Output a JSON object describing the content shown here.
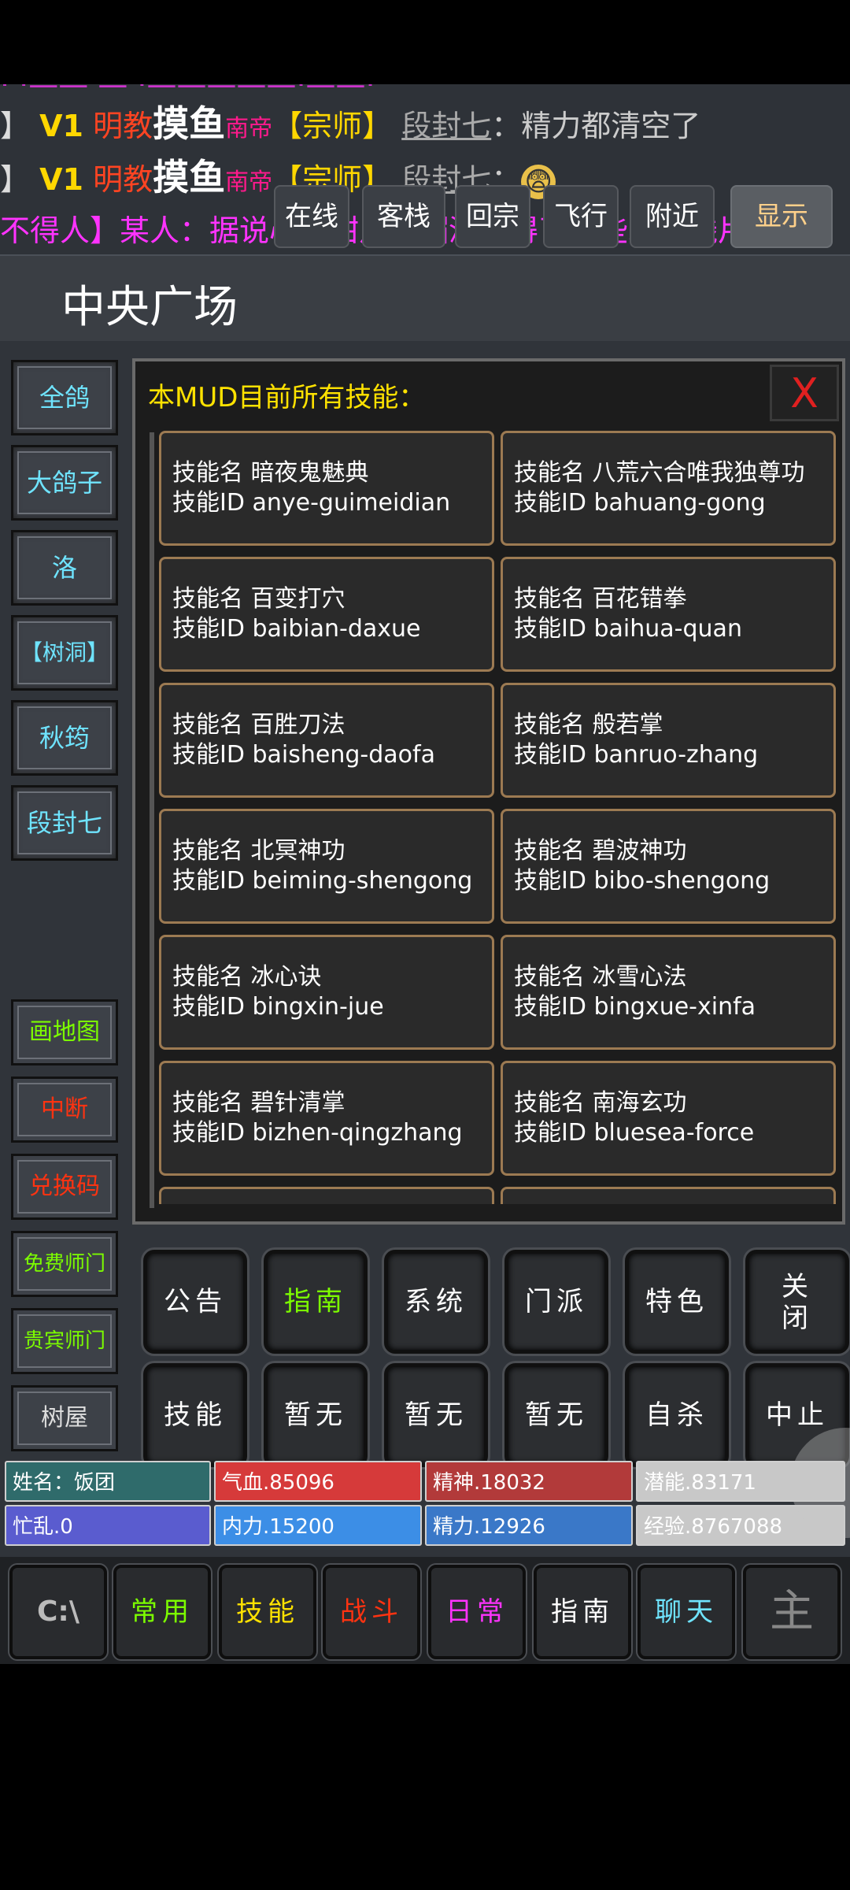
{
  "chat": {
    "cut_line": "· ·—— — ·—————·——·",
    "lines": [
      {
        "prefix": "】",
        "tag": "V1",
        "sect": "明教",
        "name": "摸鱼",
        "title": "南帝",
        "rank": "【宗师】",
        "speaker": "段封七",
        "colon": "：",
        "message": "精力都清空了"
      },
      {
        "prefix": "】",
        "tag": "V1",
        "sect": "明教",
        "name": "摸鱼",
        "title": "南帝",
        "rank": "【宗师】",
        "speaker": "段封七",
        "colon": "：",
        "message": "😨"
      }
    ],
    "system_line": "不得人】某人：据说心小甜从峨嵋派获得了一些水晶残片。"
  },
  "location": {
    "name": "中央广场",
    "buttons": [
      "在线",
      "客栈",
      "回宗",
      "飞行",
      "附近"
    ],
    "display": "显示"
  },
  "sidebar_players": [
    "全鸽",
    "大鸽子",
    "洛",
    "【树洞】",
    "秋筠",
    "段封七"
  ],
  "sidebar_tools": [
    {
      "label": "画地图",
      "color": "#7CFC00"
    },
    {
      "label": "中断",
      "color": "#ff3311"
    },
    {
      "label": "兑换码",
      "color": "#ff3311"
    },
    {
      "label": "免费师门",
      "color": "#7CFC00"
    },
    {
      "label": "贵宾师门",
      "color": "#7CFC00"
    },
    {
      "label": "树屋",
      "color": "#dddddd"
    }
  ],
  "panel": {
    "title": "本MUD目前所有技能：",
    "close": "X",
    "name_label": "技能名",
    "id_label": "技能ID",
    "skills": [
      {
        "name": "暗夜鬼魅典",
        "id": "anye-guimeidian"
      },
      {
        "name": "八荒六合唯我独尊功",
        "id": "bahuang-gong"
      },
      {
        "name": "百变打穴",
        "id": "baibian-daxue"
      },
      {
        "name": "百花错拳",
        "id": "baihua-quan"
      },
      {
        "name": "百胜刀法",
        "id": "baisheng-daofa"
      },
      {
        "name": "般若掌",
        "id": "banruo-zhang"
      },
      {
        "name": "北冥神功",
        "id": "beiming-shengong"
      },
      {
        "name": "碧波神功",
        "id": "bibo-shengong"
      },
      {
        "name": "冰心诀",
        "id": "bingxin-jue"
      },
      {
        "name": "冰雪心法",
        "id": "bingxue-xinfa"
      },
      {
        "name": "碧针清掌",
        "id": "bizhen-qingzhang"
      },
      {
        "name": "南海玄功",
        "id": "bluesea-force"
      }
    ]
  },
  "commands": [
    {
      "label": "公告",
      "color": "#ffffff"
    },
    {
      "label": "指南",
      "color": "#7CFC00"
    },
    {
      "label": "系统",
      "color": "#ffffff"
    },
    {
      "label": "门派",
      "color": "#ffffff"
    },
    {
      "label": "特色",
      "color": "#ffffff"
    },
    {
      "label": "关闭",
      "color": "#ffffff"
    },
    {
      "label": "技能",
      "color": "#ffffff"
    },
    {
      "label": "暂无",
      "color": "#ffffff"
    },
    {
      "label": "暂无",
      "color": "#ffffff"
    },
    {
      "label": "暂无",
      "color": "#ffffff"
    },
    {
      "label": "自杀",
      "color": "#ffffff"
    },
    {
      "label": "中止",
      "color": "#ffffff"
    }
  ],
  "stats": [
    {
      "label": "姓名：饭团",
      "color": "#2f6b6b",
      "fill": 1.0
    },
    {
      "label": "气血.85096",
      "color": "#d63a3a",
      "fill": 1.0
    },
    {
      "label": "精神.18032",
      "color": "#b23a3a",
      "fill": 1.0
    },
    {
      "label": "潜能.83171",
      "color": "#c8c8c8",
      "fill": 1.0
    },
    {
      "label": "忙乱.0",
      "color": "#5a5ccf",
      "fill": 1.0
    },
    {
      "label": "内力.15200",
      "color": "#3c8ee6",
      "fill": 1.0
    },
    {
      "label": "精力.12926",
      "color": "#3a78c8",
      "fill": 1.0
    },
    {
      "label": "经验.8767088",
      "color": "#c8c8c8",
      "fill": 1.0
    }
  ],
  "bottom_tabs": [
    {
      "label": "C:\\",
      "color": "#bbbbbb",
      "icon": "terminal-icon"
    },
    {
      "label": "常用",
      "color": "#7CFC00"
    },
    {
      "label": "技能",
      "color": "#ffe200"
    },
    {
      "label": "战斗",
      "color": "#ff3311"
    },
    {
      "label": "日常",
      "color": "#ff33ff"
    },
    {
      "label": "指南",
      "color": "#ffffff"
    },
    {
      "label": "聊天",
      "color": "#6fe4ff"
    },
    {
      "label": "主",
      "color": "#888888",
      "icon": "user-icon"
    }
  ]
}
